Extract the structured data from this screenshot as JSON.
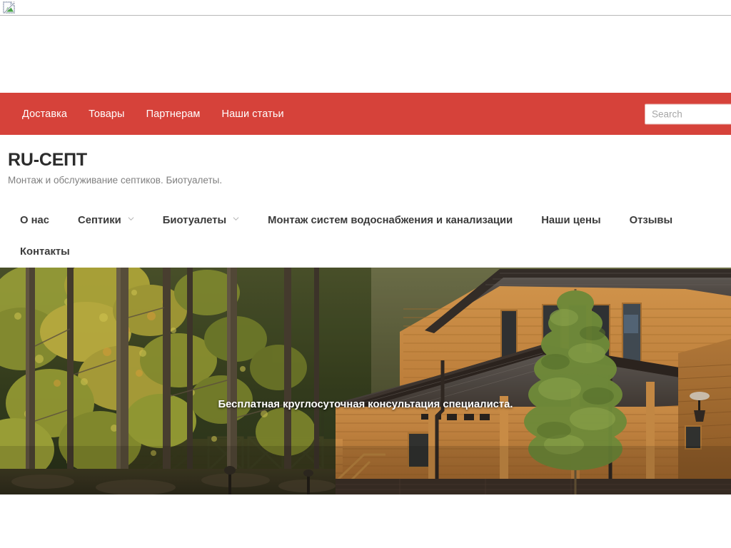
{
  "top_strip": {
    "broken_image_icon": "broken-image-icon"
  },
  "topbar": {
    "background_color": "#d6423a",
    "menu": [
      {
        "label": "Доставка"
      },
      {
        "label": "Товары"
      },
      {
        "label": "Партнерам"
      },
      {
        "label": "Наши статьи"
      }
    ],
    "search": {
      "placeholder": "Search",
      "value": ""
    }
  },
  "branding": {
    "title": "RU-СЕПТ",
    "tagline": "Монтаж и обслуживание септиков. Биотуалеты."
  },
  "mainnav": {
    "items": [
      {
        "label": "О нас",
        "has_dropdown": false
      },
      {
        "label": "Септики",
        "has_dropdown": true
      },
      {
        "label": "Биотуалеты",
        "has_dropdown": true
      },
      {
        "label": "Монтаж систем водоснабжения и канализации",
        "has_dropdown": false
      },
      {
        "label": "Наши цены",
        "has_dropdown": false
      },
      {
        "label": "Отзывы",
        "has_dropdown": false
      },
      {
        "label": "Контакты",
        "has_dropdown": false
      }
    ]
  },
  "hero": {
    "caption": "Бесплатная круглосуточная консультация специалиста.",
    "image_description": "Деревянный дом из бруса в осеннем лесу",
    "text_color": "#ffffff"
  }
}
